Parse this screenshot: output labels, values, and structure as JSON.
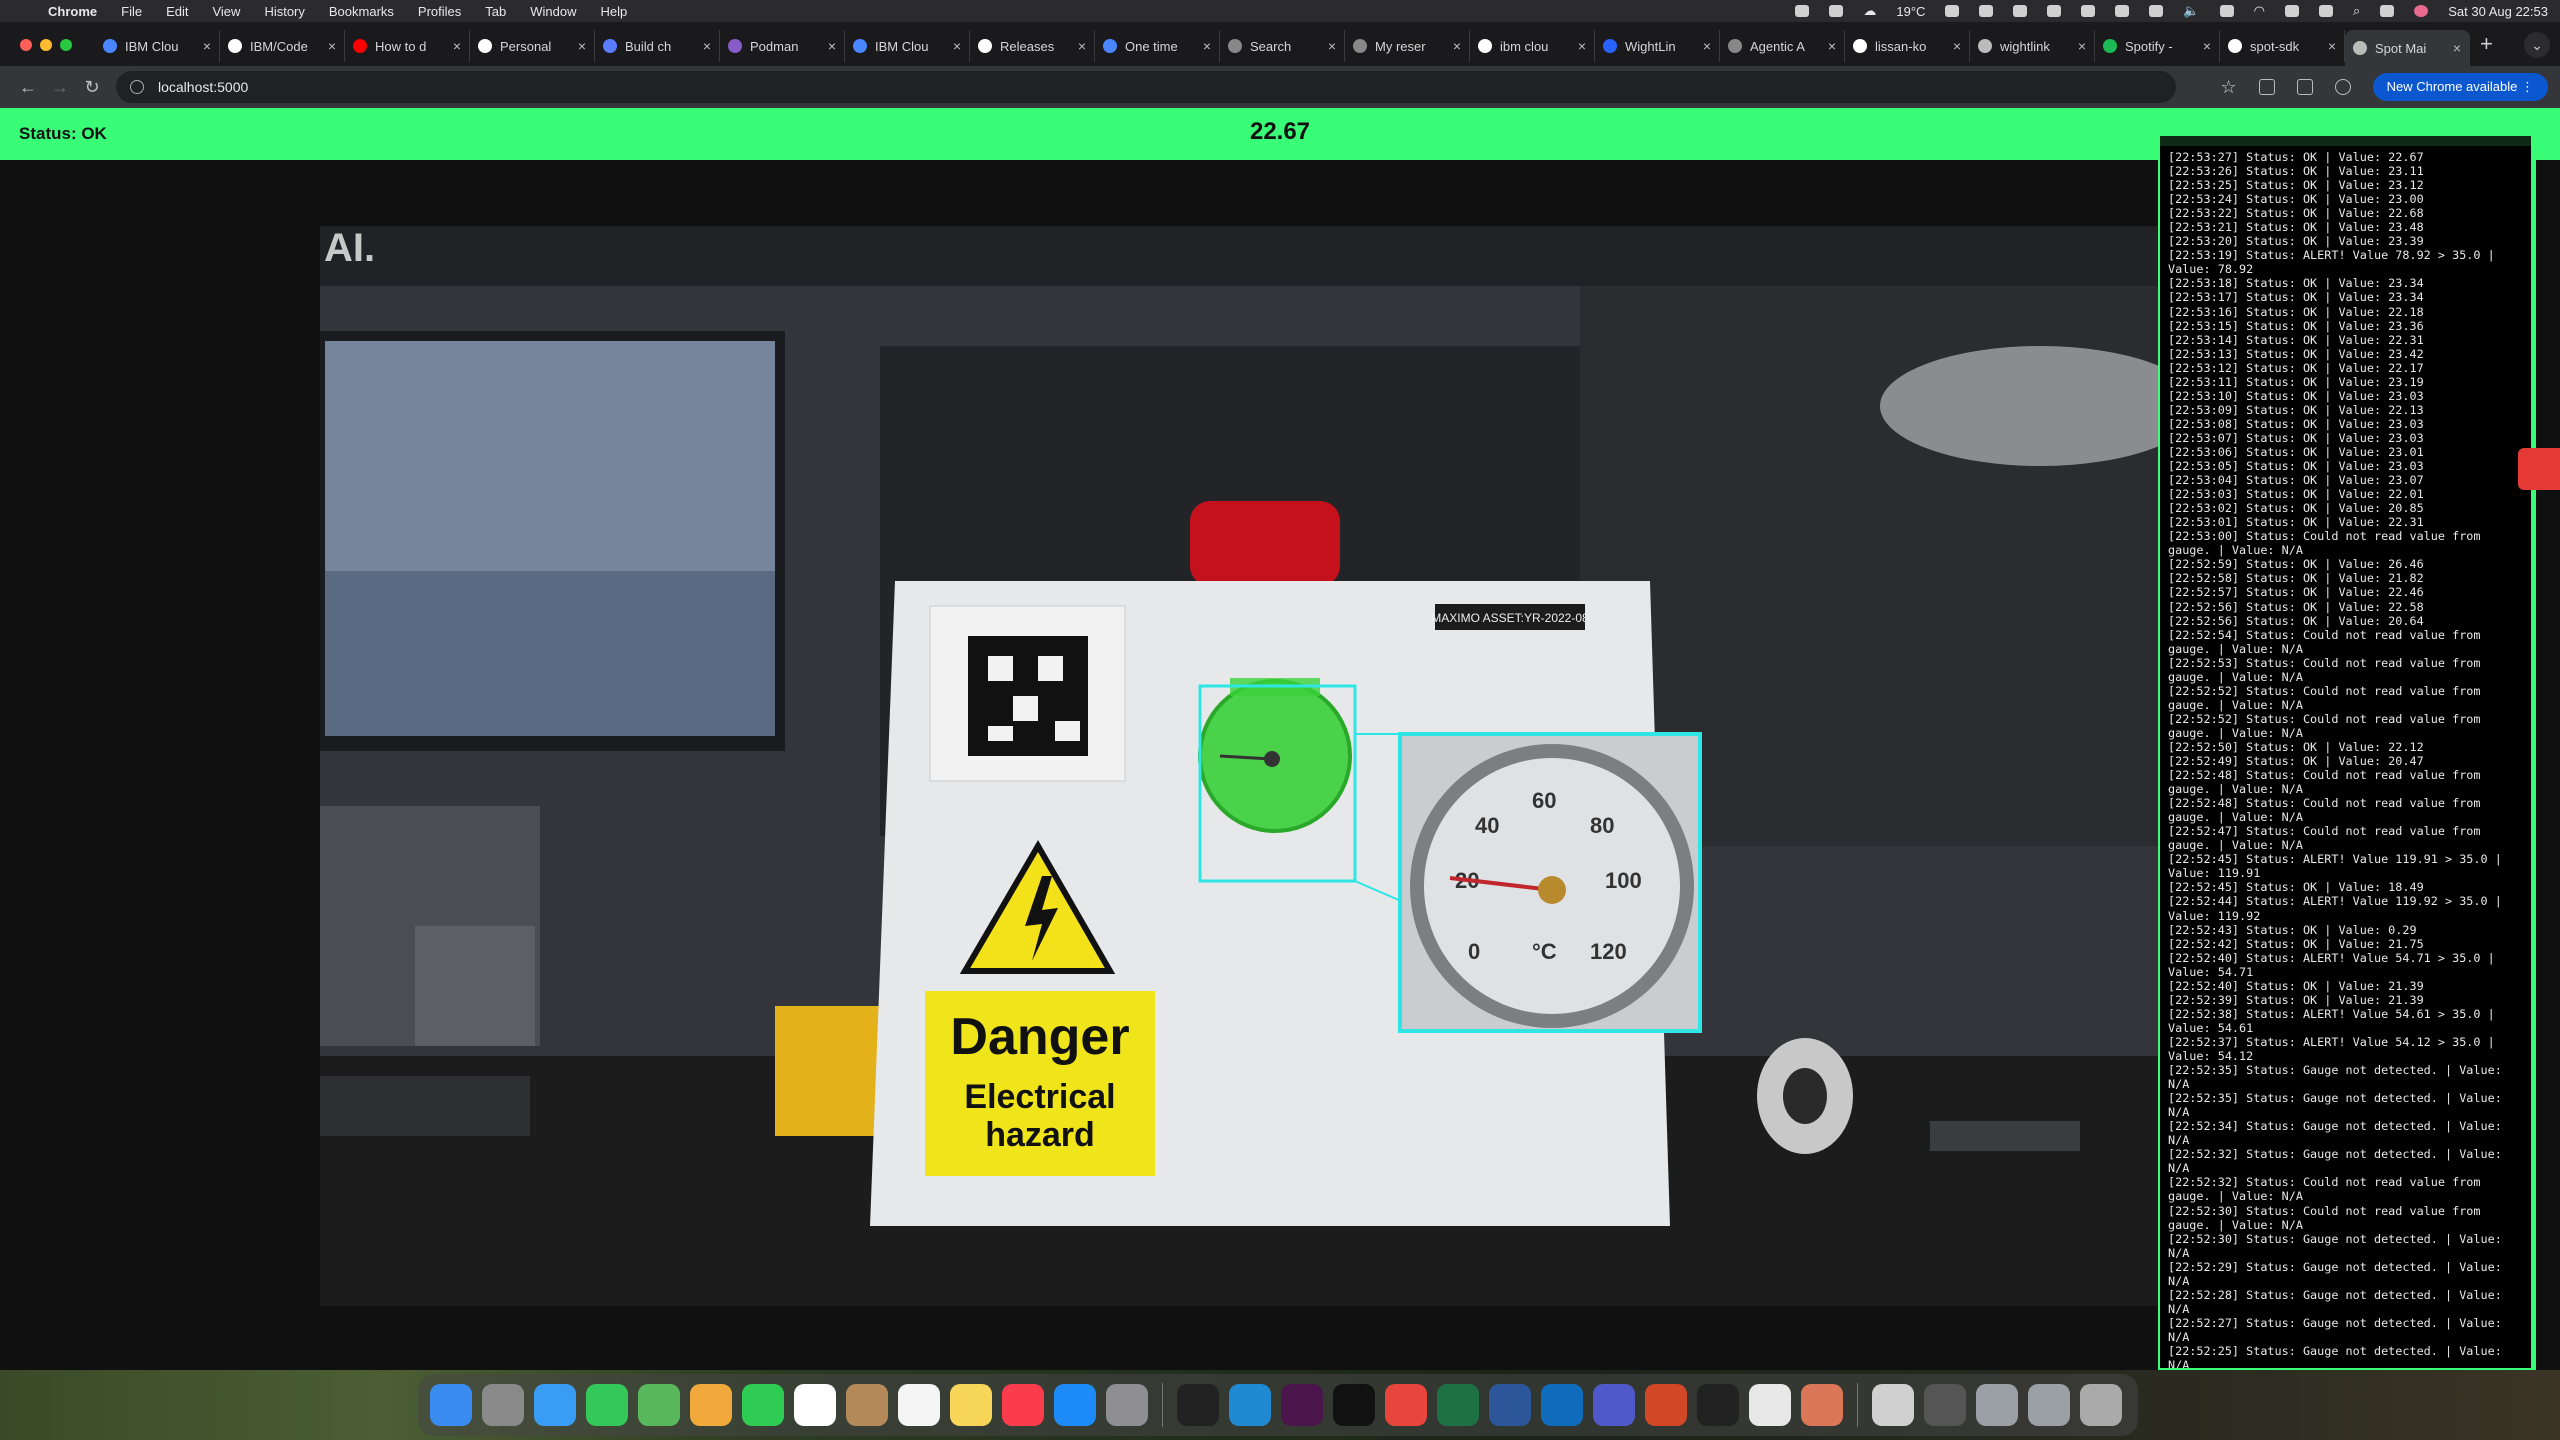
{
  "menubar": {
    "items": [
      "Chrome",
      "File",
      "Edit",
      "View",
      "History",
      "Bookmarks",
      "Profiles",
      "Tab",
      "Window",
      "Help"
    ],
    "weather": "19°C",
    "clock": "Sat 30 Aug 22:53"
  },
  "tabs": [
    {
      "label": "IBM Clou",
      "favicon_color": "#4a86ff"
    },
    {
      "label": "IBM/Code",
      "favicon_color": "#ffffff"
    },
    {
      "label": "How to d",
      "favicon_color": "#ff0000"
    },
    {
      "label": "Personal",
      "favicon_color": "#ffffff"
    },
    {
      "label": "Build ch",
      "favicon_color": "#5b7cff"
    },
    {
      "label": "Podman",
      "favicon_color": "#8a5cc9"
    },
    {
      "label": "IBM Clou",
      "favicon_color": "#4a86ff"
    },
    {
      "label": "Releases",
      "favicon_color": "#ffffff"
    },
    {
      "label": "One time",
      "favicon_color": "#4a86ff"
    },
    {
      "label": "Search",
      "favicon_color": "#888888"
    },
    {
      "label": "My reser",
      "favicon_color": "#888888"
    },
    {
      "label": "ibm clou",
      "favicon_color": "#ffffff"
    },
    {
      "label": "WightLin",
      "favicon_color": "#2962ff"
    },
    {
      "label": "Agentic A",
      "favicon_color": "#888888"
    },
    {
      "label": "lissan-ko",
      "favicon_color": "#ffffff"
    },
    {
      "label": "wightlink",
      "favicon_color": "#bbbbbb"
    },
    {
      "label": "Spotify -",
      "favicon_color": "#1db954"
    },
    {
      "label": "spot-sdk",
      "favicon_color": "#ffffff"
    },
    {
      "label": "Spot Mai",
      "favicon_color": "#bbbbbb",
      "active": true
    }
  ],
  "toolbar": {
    "url": "localhost:5000",
    "update_label": "New Chrome available"
  },
  "status": {
    "text": "Status: OK",
    "reading": "22.67",
    "bar_color": "#39fc77"
  },
  "scene": {
    "asset_tag": "MAXIMO ASSET:YR-2022-08",
    "danger_title": "Danger",
    "danger_line1": "Electrical",
    "danger_line2": "hazard",
    "gauge_unit": "°C",
    "gauge_ticks": [
      "0",
      "20",
      "40",
      "60",
      "80",
      "100",
      "120"
    ],
    "detection_color": "#2ee6e6",
    "gauge_highlight_color": "#32e632",
    "corner_text": "AI."
  },
  "log": [
    "[22:53:27] Status: OK | Value: 22.67",
    "[22:53:26] Status: OK | Value: 23.11",
    "[22:53:25] Status: OK | Value: 23.12",
    "[22:53:24] Status: OK | Value: 23.00",
    "[22:53:22] Status: OK | Value: 22.68",
    "[22:53:21] Status: OK | Value: 23.48",
    "[22:53:20] Status: OK | Value: 23.39",
    "[22:53:19] Status: ALERT! Value 78.92 > 35.0 | Value: 78.92",
    "[22:53:18] Status: OK | Value: 23.34",
    "[22:53:17] Status: OK | Value: 23.34",
    "[22:53:16] Status: OK | Value: 22.18",
    "[22:53:15] Status: OK | Value: 23.36",
    "[22:53:14] Status: OK | Value: 22.31",
    "[22:53:13] Status: OK | Value: 23.42",
    "[22:53:12] Status: OK | Value: 22.17",
    "[22:53:11] Status: OK | Value: 23.19",
    "[22:53:10] Status: OK | Value: 23.03",
    "[22:53:09] Status: OK | Value: 22.13",
    "[22:53:08] Status: OK | Value: 23.03",
    "[22:53:07] Status: OK | Value: 23.03",
    "[22:53:06] Status: OK | Value: 23.01",
    "[22:53:05] Status: OK | Value: 23.03",
    "[22:53:04] Status: OK | Value: 23.07",
    "[22:53:03] Status: OK | Value: 22.01",
    "[22:53:02] Status: OK | Value: 20.85",
    "[22:53:01] Status: OK | Value: 22.31",
    "[22:53:00] Status: Could not read value from gauge. | Value: N/A",
    "[22:52:59] Status: OK | Value: 26.46",
    "[22:52:58] Status: OK | Value: 21.82",
    "[22:52:57] Status: OK | Value: 22.46",
    "[22:52:56] Status: OK | Value: 22.58",
    "[22:52:56] Status: OK | Value: 20.64",
    "[22:52:54] Status: Could not read value from gauge. | Value: N/A",
    "[22:52:53] Status: Could not read value from gauge. | Value: N/A",
    "[22:52:52] Status: Could not read value from gauge. | Value: N/A",
    "[22:52:52] Status: Could not read value from gauge. | Value: N/A",
    "[22:52:50] Status: OK | Value: 22.12",
    "[22:52:49] Status: OK | Value: 20.47",
    "[22:52:48] Status: Could not read value from gauge. | Value: N/A",
    "[22:52:48] Status: Could not read value from gauge. | Value: N/A",
    "[22:52:47] Status: Could not read value from gauge. | Value: N/A",
    "[22:52:45] Status: ALERT! Value 119.91 > 35.0 | Value: 119.91",
    "[22:52:45] Status: OK | Value: 18.49",
    "[22:52:44] Status: ALERT! Value 119.92 > 35.0 | Value: 119.92",
    "[22:52:43] Status: OK | Value: 0.29",
    "[22:52:42] Status: OK | Value: 21.75",
    "[22:52:40] Status: ALERT! Value 54.71 > 35.0 | Value: 54.71",
    "[22:52:40] Status: OK | Value: 21.39",
    "[22:52:39] Status: OK | Value: 21.39",
    "[22:52:38] Status: ALERT! Value 54.61 > 35.0 | Value: 54.61",
    "[22:52:37] Status: ALERT! Value 54.12 > 35.0 | Value: 54.12",
    "[22:52:35] Status: Gauge not detected. | Value: N/A",
    "[22:52:35] Status: Gauge not detected. | Value: N/A",
    "[22:52:34] Status: Gauge not detected. | Value: N/A",
    "[22:52:32] Status: Gauge not detected. | Value: N/A",
    "[22:52:32] Status: Could not read value from gauge. | Value: N/A",
    "[22:52:30] Status: Could not read value from gauge. | Value: N/A",
    "[22:52:30] Status: Gauge not detected. | Value: N/A",
    "[22:52:29] Status: Gauge not detected. | Value: N/A",
    "[22:52:28] Status: Gauge not detected. | Value: N/A",
    "[22:52:27] Status: Gauge not detected. | Value: N/A",
    "[22:52:25] Status: Gauge not detected. | Value: N/A"
  ],
  "dock_apps": [
    {
      "name": "finder",
      "color": "#3b8cf0"
    },
    {
      "name": "launchpad",
      "color": "#8a8a8a"
    },
    {
      "name": "safari",
      "color": "#3a9df5"
    },
    {
      "name": "messages",
      "color": "#34c759"
    },
    {
      "name": "maps",
      "color": "#59b85c"
    },
    {
      "name": "photos",
      "color": "#f2a93b"
    },
    {
      "name": "facetime",
      "color": "#2ecc52"
    },
    {
      "name": "calendar",
      "color": "#ffffff"
    },
    {
      "name": "contacts",
      "color": "#b48a5a"
    },
    {
      "name": "reminders",
      "color": "#f5f5f5"
    },
    {
      "name": "notes",
      "color": "#f7d65a"
    },
    {
      "name": "music",
      "color": "#fa3c4c"
    },
    {
      "name": "app-store",
      "color": "#1d8cf8"
    },
    {
      "name": "system-settings",
      "color": "#8e8e93"
    },
    {
      "name": "activity-monitor",
      "color": "#222222"
    },
    {
      "name": "vscode",
      "color": "#1f8ad2"
    },
    {
      "name": "slack",
      "color": "#4a154b"
    },
    {
      "name": "terminal",
      "color": "#111111"
    },
    {
      "name": "chrome",
      "color": "#e8453c"
    },
    {
      "name": "excel",
      "color": "#1e7145"
    },
    {
      "name": "word",
      "color": "#2b579a"
    },
    {
      "name": "outlook",
      "color": "#0f6cbd"
    },
    {
      "name": "teams",
      "color": "#5059c9"
    },
    {
      "name": "powerpoint",
      "color": "#d24726"
    },
    {
      "name": "unity",
      "color": "#222222"
    },
    {
      "name": "chatgpt",
      "color": "#e8e8e8"
    },
    {
      "name": "claude",
      "color": "#d97757"
    },
    {
      "name": "preview",
      "color": "#d0d0d0"
    },
    {
      "name": "screenshot-folder",
      "color": "#555555"
    },
    {
      "name": "downloads-folder",
      "color": "#9aa0a6"
    },
    {
      "name": "documents-folder",
      "color": "#9aa0a6"
    },
    {
      "name": "trash",
      "color": "#aaaaaa"
    }
  ]
}
